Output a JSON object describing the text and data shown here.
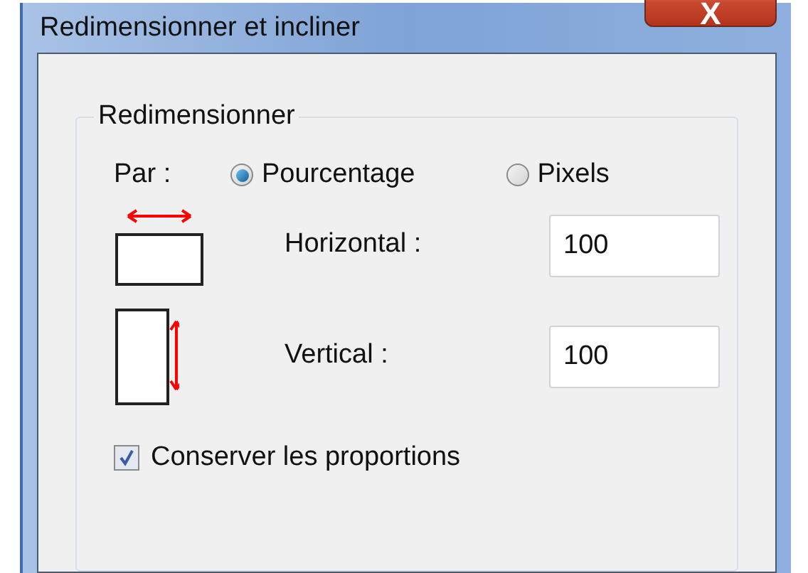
{
  "window": {
    "title": "Redimensionner et incliner",
    "close": "X"
  },
  "group": {
    "title": "Redimensionner",
    "by_label": "Par :",
    "units": [
      {
        "label": "Pourcentage",
        "selected": true
      },
      {
        "label": "Pixels",
        "selected": false
      }
    ],
    "fields": [
      {
        "kind": "horizontal",
        "label": "Horizontal :",
        "value": "100"
      },
      {
        "kind": "vertical",
        "label": "Vertical :",
        "value": "100"
      }
    ],
    "keep_ratio": {
      "label": "Conserver les proportions",
      "checked": true
    }
  }
}
